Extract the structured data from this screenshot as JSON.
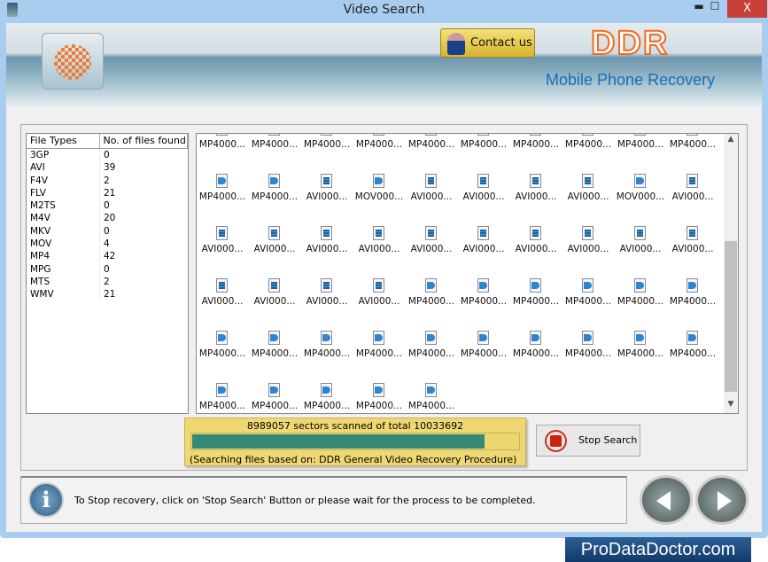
{
  "window": {
    "title": "Video Search",
    "minimize": "▬",
    "maximize": "☐",
    "close": "X"
  },
  "header": {
    "contact_label": "Contact us",
    "brand": "DDR",
    "product": "Mobile Phone Recovery"
  },
  "file_types": {
    "headers": [
      "File Types",
      "No. of files found"
    ],
    "rows": [
      [
        "3GP",
        "0"
      ],
      [
        "AVI",
        "39"
      ],
      [
        "F4V",
        "2"
      ],
      [
        "FLV",
        "21"
      ],
      [
        "M2TS",
        "0"
      ],
      [
        "M4V",
        "20"
      ],
      [
        "MKV",
        "0"
      ],
      [
        "MOV",
        "4"
      ],
      [
        "MP4",
        "42"
      ],
      [
        "MPG",
        "0"
      ],
      [
        "MTS",
        "2"
      ],
      [
        "WMV",
        "21"
      ]
    ]
  },
  "files": [
    [
      "mp4",
      "mp4",
      "mp4",
      "mp4",
      "mp4",
      "mp4",
      "mp4",
      "mp4",
      "mp4",
      "mp4"
    ],
    [
      "mp4",
      "mp4",
      "avi",
      "mov",
      "avi",
      "avi",
      "avi",
      "avi",
      "mov",
      "avi"
    ],
    [
      "avi",
      "avi",
      "avi",
      "avi",
      "avi",
      "avi",
      "avi",
      "avi",
      "avi",
      "avi"
    ],
    [
      "avi",
      "avi",
      "avi",
      "avi",
      "mp4",
      "mp4",
      "mp4",
      "mp4",
      "mp4",
      "mp4"
    ],
    [
      "mp4",
      "mp4",
      "mp4",
      "mp4",
      "mp4",
      "mp4",
      "mp4",
      "mp4",
      "mp4",
      "mp4"
    ],
    [
      "mp4",
      "mp4",
      "mp4",
      "mp4",
      "mp4"
    ]
  ],
  "file_labels": {
    "mp4": "MP4000...",
    "avi": "AVI000...",
    "mov": "MOV000..."
  },
  "progress": {
    "text": "8989057 sectors scanned of total 10033692",
    "scanned": 8989057,
    "total": 10033692,
    "fraction": 0.896,
    "based_on": "(Searching files based on:  DDR General Video Recovery Procedure)",
    "fill_color": "#348a74"
  },
  "stop_label": "Stop Search",
  "status_message": "To Stop recovery, click on 'Stop Search' Button or please wait for the process to be completed.",
  "footer_brand": "ProDataDoctor.com"
}
